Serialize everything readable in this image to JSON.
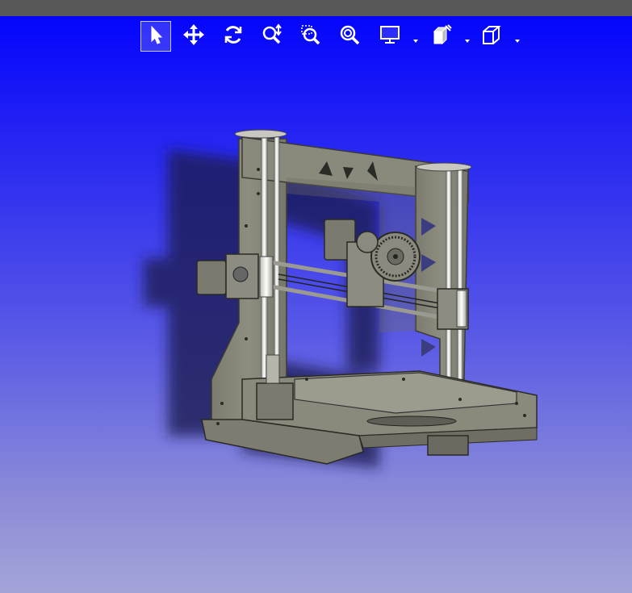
{
  "toolbar": {
    "tools": [
      {
        "name": "select-tool-button",
        "icon": "cursor-arrow-icon",
        "active": true
      },
      {
        "name": "pan-tool-button",
        "icon": "move-arrows-icon",
        "active": false
      },
      {
        "name": "rotate-tool-button",
        "icon": "rotate-icon",
        "active": false
      },
      {
        "name": "zoom-tool-button",
        "icon": "zoom-updown-icon",
        "active": false
      },
      {
        "name": "zoom-window-button",
        "icon": "zoom-window-icon",
        "active": false
      },
      {
        "name": "zoom-fit-button",
        "icon": "zoom-fit-icon",
        "active": false
      },
      {
        "name": "display-mode-button",
        "icon": "monitor-icon",
        "active": false,
        "dropdown": true
      },
      {
        "name": "section-view-button",
        "icon": "cube-section-icon",
        "active": false,
        "dropdown": true
      },
      {
        "name": "standard-views-button",
        "icon": "cube-wireframe-icon",
        "active": false,
        "dropdown": true
      }
    ]
  },
  "viewport": {
    "model": "3d-printer-frame-model",
    "background_top": "#0000ff",
    "background_bottom": "#a4a4d8",
    "model_color": "#8a8a7c"
  }
}
